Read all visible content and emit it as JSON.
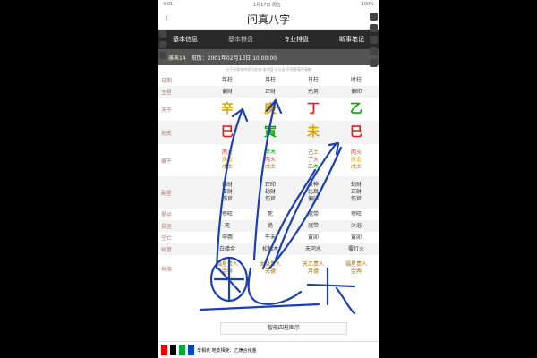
{
  "status": {
    "time": "4:01",
    "date": "1月17日 周五",
    "battery": "100%"
  },
  "header": {
    "title": "问真八字",
    "back": "‹"
  },
  "tabs": [
    {
      "label": "基本信息"
    },
    {
      "label": "基本排盘"
    },
    {
      "label": "专业排盘"
    },
    {
      "label": "断事笔记"
    }
  ],
  "subbar": {
    "tag": "雅典14",
    "date": "阳历：2001年02月13日 10:00:00"
  },
  "note": "以下分享仅供学习交流 本内容 可以去 不同等高手请教",
  "grid": {
    "header": [
      "日期",
      "年柱",
      "月柱",
      "日柱",
      "时柱"
    ],
    "zhuxing": {
      "label": "主星",
      "cells": [
        "偏财",
        "正财",
        "元男",
        "偏印"
      ]
    },
    "tiangan": {
      "label": "天干",
      "cells": [
        "辛",
        "庚",
        "丁",
        "乙"
      ],
      "colors": [
        "#d9a400",
        "#d9a400",
        "#d22",
        "#0a0"
      ]
    },
    "dizhi": {
      "label": "地支",
      "cells": [
        "巳",
        "寅",
        "未",
        "巳"
      ],
      "colors": [
        "#d22",
        "#0a0",
        "#d9a400",
        "#d22"
      ]
    },
    "canggan": {
      "label": "藏干",
      "cells": [
        [
          "丙火",
          "庚金",
          "戊土"
        ],
        [
          "甲木",
          "丙火",
          "戊土"
        ],
        [
          "己土",
          "丁火",
          "乙木"
        ],
        [
          "丙火",
          "庚金",
          "戊土"
        ]
      ]
    },
    "fuxing": {
      "label": "副星",
      "cells": [
        [
          "劫财",
          "正财",
          "伤官"
        ],
        [
          "正印",
          "劫财",
          "伤官"
        ],
        [
          "食神",
          "比肩",
          "偏印"
        ],
        [
          "劫财",
          "正财",
          "伤官"
        ]
      ]
    },
    "xingyun": {
      "label": "星运",
      "cells": [
        "帝旺",
        "死",
        "冠带",
        "帝旺"
      ]
    },
    "zizuo": {
      "label": "自坐",
      "cells": [
        "死",
        "绝",
        "冠带",
        "沐浴"
      ]
    },
    "kongwang": {
      "label": "空亡",
      "cells": [
        "申酉",
        "午未",
        "寅卯",
        "寅卯"
      ]
    },
    "nayin": {
      "label": "纳音",
      "cells": [
        "白蜡金",
        "松柏木",
        "天河水",
        "覆灯火"
      ]
    },
    "shensha": {
      "label": "神煞",
      "cells": [
        [
          "福星贵人",
          "金舆"
        ],
        [
          "太极贵人",
          "天德"
        ],
        [
          "天乙贵人",
          "月德"
        ],
        [
          "福星贵人",
          "金舆"
        ]
      ]
    }
  },
  "footer": {
    "button": "智能四柱图示",
    "hint": "辛相克 地支相克：乙庚合化金"
  },
  "pen_colors": [
    "#e00",
    "#000",
    "#0a3",
    "#04c"
  ]
}
